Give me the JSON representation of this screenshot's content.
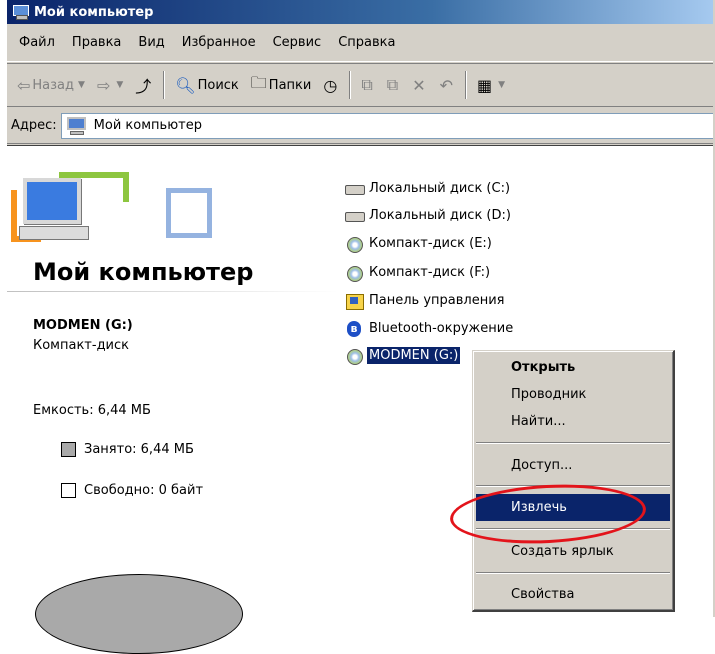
{
  "window": {
    "title": "Мой компьютер"
  },
  "menubar": {
    "items": [
      "Файл",
      "Правка",
      "Вид",
      "Избранное",
      "Сервис",
      "Справка"
    ]
  },
  "toolbar": {
    "back_label": "Назад",
    "search_label": "Поиск",
    "folders_label": "Папки"
  },
  "addressbar": {
    "label": "Адрес:",
    "value": "Мой компьютер"
  },
  "left_panel": {
    "title": "Мой компьютер",
    "selected_name": "MODMEN (G:)",
    "selected_type": "Компакт-диск",
    "capacity": "Емкость: 6,44 МБ",
    "used": "Занято: 6,44 МБ",
    "free": "Свободно: 0 байт",
    "used_fraction": 1.0
  },
  "items": [
    {
      "label": "Локальный диск (C:)",
      "icon": "hard-drive-icon"
    },
    {
      "label": "Локальный диск (D:)",
      "icon": "hard-drive-icon"
    },
    {
      "label": "Компакт-диск (E:)",
      "icon": "cd-drive-icon"
    },
    {
      "label": "Компакт-диск (F:)",
      "icon": "cd-drive-icon"
    },
    {
      "label": "Панель управления",
      "icon": "control-panel-icon"
    },
    {
      "label": "Bluetooth-окружение",
      "icon": "bluetooth-icon"
    },
    {
      "label": "MODMEN (G:)",
      "icon": "cd-drive-icon",
      "selected": true
    }
  ],
  "context_menu": {
    "open": "Открыть",
    "explorer": "Проводник",
    "find": "Найти...",
    "sharing": "Доступ...",
    "eject": "Извлечь",
    "create_shortcut": "Создать ярлык",
    "properties": "Свойства"
  },
  "colors": {
    "selection": "#0a246a",
    "highlight_ellipse": "#e3141b",
    "face": "#d4d0c8"
  }
}
